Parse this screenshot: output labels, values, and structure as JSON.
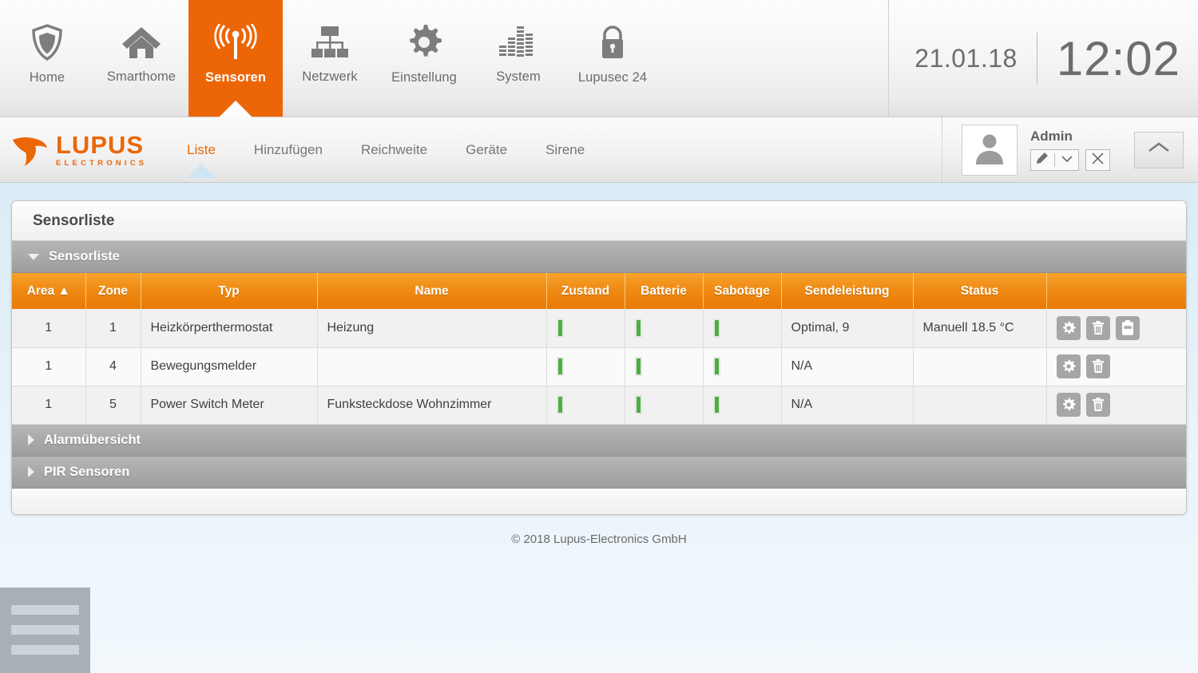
{
  "topnav": {
    "items": [
      {
        "label": "Home",
        "icon": "shield-icon",
        "active": false
      },
      {
        "label": "Smarthome",
        "icon": "house-icon",
        "active": false
      },
      {
        "label": "Sensoren",
        "icon": "antenna-signal-icon",
        "active": true
      },
      {
        "label": "Netzwerk",
        "icon": "network-tree-icon",
        "active": false
      },
      {
        "label": "Einstellung",
        "icon": "gear-icon",
        "active": false
      },
      {
        "label": "System",
        "icon": "equalizer-icon",
        "active": false
      },
      {
        "label": "Lupusec 24",
        "icon": "lock-icon",
        "active": false
      }
    ],
    "date": "21.01.18",
    "time": "12:02"
  },
  "brand": {
    "name": "LUPUS",
    "tagline": "ELECTRONICS",
    "color": "#ec6608",
    "logo_icon": "wolf-head-icon"
  },
  "subnav": {
    "items": [
      {
        "label": "Liste",
        "active": true
      },
      {
        "label": "Hinzufügen",
        "active": false
      },
      {
        "label": "Reichweite",
        "active": false
      },
      {
        "label": "Geräte",
        "active": false
      },
      {
        "label": "Sirene",
        "active": false
      }
    ]
  },
  "user": {
    "name": "Admin",
    "avatar_icon": "user-avatar-icon",
    "edit_icon": "pencil-icon",
    "dropdown_icon": "chevron-down-icon",
    "close_icon": "close-x-icon",
    "collapse_icon": "chevron-up-icon"
  },
  "panel": {
    "title": "Sensorliste",
    "sections": [
      {
        "label": "Sensorliste",
        "expanded": true
      },
      {
        "label": "Alarmübersicht",
        "expanded": false
      },
      {
        "label": "PIR Sensoren",
        "expanded": false
      }
    ]
  },
  "table": {
    "columns": [
      "Area ▲",
      "Zone",
      "Typ",
      "Name",
      "Zustand",
      "Batterie",
      "Sabotage",
      "Sendeleistung",
      "Status",
      ""
    ],
    "sort": {
      "column": "Area",
      "direction": "asc"
    },
    "status_ok_color": "#4caf3f",
    "rows": [
      {
        "area": "1",
        "zone": "1",
        "typ": "Heizkörperthermostat",
        "name": "Heizung",
        "zustand": "ok",
        "batterie": "ok",
        "sabotage": "ok",
        "sendeleistung": "Optimal, 9",
        "status": "Manuell 18.5 °C",
        "actions": [
          "gear-icon",
          "trash-icon",
          "save-icon"
        ]
      },
      {
        "area": "1",
        "zone": "4",
        "typ": "Bewegungsmelder",
        "name": "",
        "zustand": "ok",
        "batterie": "ok",
        "sabotage": "ok",
        "sendeleistung": "N/A",
        "status": "",
        "actions": [
          "gear-icon",
          "trash-icon"
        ]
      },
      {
        "area": "1",
        "zone": "5",
        "typ": "Power Switch Meter",
        "name": "Funksteckdose Wohnzimmer",
        "zustand": "ok",
        "batterie": "ok",
        "sabotage": "ok",
        "sendeleistung": "N/A",
        "status": "",
        "actions": [
          "gear-icon",
          "trash-icon"
        ]
      }
    ]
  },
  "footer": {
    "copyright": "© 2018 Lupus-Electronics GmbH"
  },
  "corner_menu": {
    "icon": "hamburger-menu-icon"
  }
}
